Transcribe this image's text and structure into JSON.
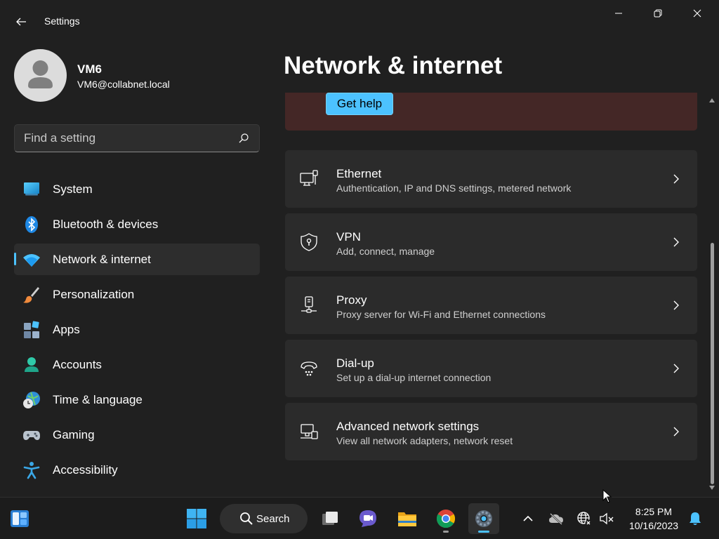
{
  "window": {
    "app_title": "Settings",
    "controls": {
      "minimize_icon": "minimize-icon",
      "maximize_icon": "restore-icon",
      "close_icon": "close-icon"
    }
  },
  "profile": {
    "name": "VM6",
    "email": "VM6@collabnet.local"
  },
  "search": {
    "placeholder": "Find a setting",
    "value": ""
  },
  "sidebar": {
    "items": [
      {
        "label": "System",
        "icon": "system-icon",
        "active": false
      },
      {
        "label": "Bluetooth & devices",
        "icon": "bluetooth-icon",
        "active": false
      },
      {
        "label": "Network & internet",
        "icon": "wifi-icon",
        "active": true
      },
      {
        "label": "Personalization",
        "icon": "brush-icon",
        "active": false
      },
      {
        "label": "Apps",
        "icon": "apps-icon",
        "active": false
      },
      {
        "label": "Accounts",
        "icon": "accounts-icon",
        "active": false
      },
      {
        "label": "Time & language",
        "icon": "time-language-icon",
        "active": false
      },
      {
        "label": "Gaming",
        "icon": "gamepad-icon",
        "active": false
      },
      {
        "label": "Accessibility",
        "icon": "accessibility-icon",
        "active": false
      }
    ]
  },
  "main": {
    "title": "Network & internet",
    "help_button": "Get help",
    "cards": [
      {
        "title": "Ethernet",
        "description": "Authentication, IP and DNS settings, metered network",
        "icon": "ethernet-icon"
      },
      {
        "title": "VPN",
        "description": "Add, connect, manage",
        "icon": "vpn-shield-icon"
      },
      {
        "title": "Proxy",
        "description": "Proxy server for Wi-Fi and Ethernet connections",
        "icon": "proxy-icon"
      },
      {
        "title": "Dial-up",
        "description": "Set up a dial-up internet connection",
        "icon": "dial-up-icon"
      },
      {
        "title": "Advanced network settings",
        "description": "View all network adapters, network reset",
        "icon": "advanced-network-icon"
      }
    ]
  },
  "taskbar": {
    "search_label": "Search",
    "apps": [
      "widgets-icon",
      "start-icon",
      "task-view-icon",
      "teams-chat-icon",
      "file-explorer-icon",
      "chrome-icon",
      "settings-icon"
    ],
    "tray": [
      "chevron-up-icon",
      "onedrive-offline-icon",
      "network-globe-icon",
      "volume-muted-icon",
      "notification-bell-icon"
    ],
    "time": "8:25 PM",
    "date": "10/16/2023"
  },
  "colors": {
    "accent": "#4cc2ff",
    "background": "#202020",
    "card": "#2b2b2b",
    "help_card": "#442726"
  }
}
